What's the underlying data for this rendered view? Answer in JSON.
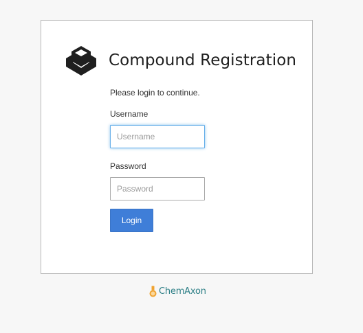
{
  "app": {
    "title": "Compound Registration",
    "logo_icon": "cube-box-icon"
  },
  "login": {
    "prompt": "Please login to continue.",
    "username_label": "Username",
    "username_placeholder": "Username",
    "username_value": "",
    "password_label": "Password",
    "password_placeholder": "Password",
    "password_value": "",
    "submit_label": "Login"
  },
  "footer": {
    "brand": "ChemAxon",
    "brand_icon": "flask-icon"
  },
  "colors": {
    "accent": "#3f7ed8",
    "focus_ring": "#66afe9",
    "footer_brand": "#2d7f86",
    "flask": "#f0a331"
  }
}
